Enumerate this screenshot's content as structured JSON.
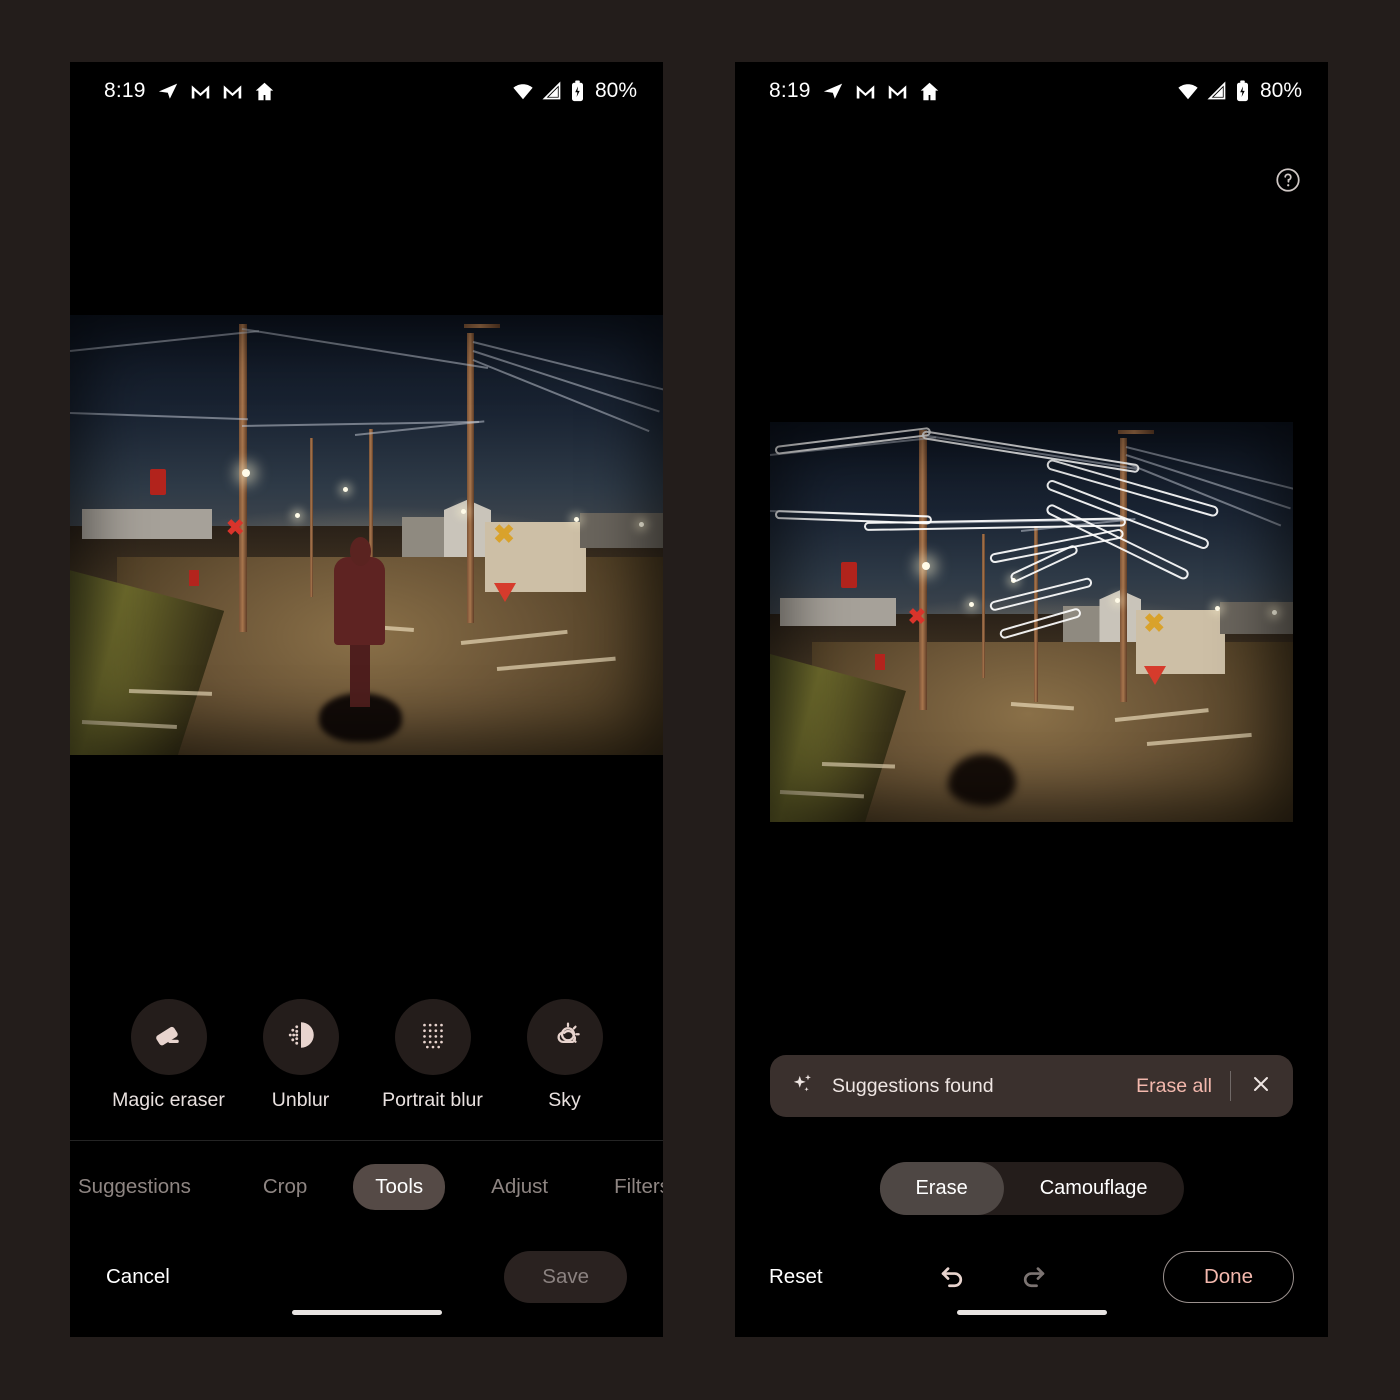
{
  "colors": {
    "page_background": "#231d1b",
    "phone_background": "#000000",
    "accent_pink": "#f3b8ad",
    "surface": "#3a302d",
    "active_tab": "#554a46",
    "disabled_text": "#8b8280"
  },
  "status_bar": {
    "time": "8:19",
    "icons_left": [
      "telegram-icon",
      "gmail-icon",
      "gmail-icon",
      "home-icon"
    ],
    "icons_right": [
      "wifi-icon",
      "cellular-signal-icon",
      "battery-icon"
    ],
    "battery_percent": "80%"
  },
  "left_phone": {
    "tools": [
      {
        "label": "Magic eraser",
        "icon": "eraser-icon"
      },
      {
        "label": "Unblur",
        "icon": "unblur-icon"
      },
      {
        "label": "Portrait blur",
        "icon": "portrait-blur-icon"
      },
      {
        "label": "Sky",
        "icon": "sky-icon"
      }
    ],
    "tabs": [
      {
        "label": "Suggestions",
        "active": false
      },
      {
        "label": "Crop",
        "active": false
      },
      {
        "label": "Tools",
        "active": true
      },
      {
        "label": "Adjust",
        "active": false
      },
      {
        "label": "Filters",
        "active": false
      }
    ],
    "cancel_label": "Cancel",
    "save_label": "Save"
  },
  "right_phone": {
    "help_icon": "help-circle-icon",
    "suggestion_bar": {
      "icon": "sparkle-icon",
      "label": "Suggestions found",
      "action_label": "Erase all",
      "close_icon": "close-icon"
    },
    "mode_toggle": [
      {
        "label": "Erase",
        "active": true
      },
      {
        "label": "Camouflage",
        "active": false
      }
    ],
    "reset_label": "Reset",
    "undo_icon": "undo-icon",
    "redo_icon": "redo-icon",
    "done_label": "Done"
  },
  "photo": {
    "description": "Night street scene with power poles, overhead wires, streetlights, railroad crossing signs and buildings",
    "left_has_person": true,
    "right_has_person": false
  }
}
